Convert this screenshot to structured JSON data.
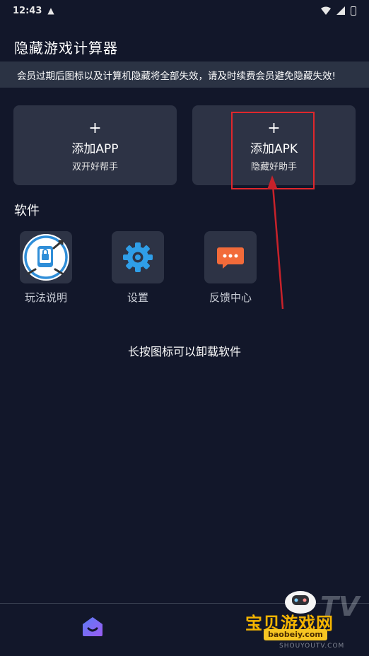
{
  "status_bar": {
    "time": "12:43",
    "warning_icon": "warning-icon"
  },
  "app": {
    "title": "隐藏游戏计算器"
  },
  "notice": "会员过期后图标以及计算机隐藏将全部失效，请及时续费会员避免隐藏失效!",
  "cards": [
    {
      "plus": "+",
      "name": "添加APP",
      "sub": "双开好帮手",
      "icon": "plus-icon"
    },
    {
      "plus": "+",
      "name": "添加APK",
      "sub": "隐藏好助手",
      "icon": "plus-icon"
    }
  ],
  "software": {
    "title": "软件",
    "items": [
      {
        "label": "玩法说明",
        "icon": "guide-lock-icon"
      },
      {
        "label": "设置",
        "icon": "gear-icon"
      },
      {
        "label": "反馈中心",
        "icon": "chat-bubble-icon"
      }
    ]
  },
  "hint": "长按图标可以卸载软件",
  "bottom_nav": {
    "home_icon": "home-icon"
  },
  "watermark": {
    "title": "宝贝游戏网",
    "url": "baobeiy.com",
    "tv": "TV",
    "site": "SHOUYOUTV.COM"
  },
  "colors": {
    "background": "#12172a",
    "card": "#2d3345",
    "notice": "#2b3344",
    "highlight": "#e0272c",
    "accent": "#2f8ed8"
  }
}
